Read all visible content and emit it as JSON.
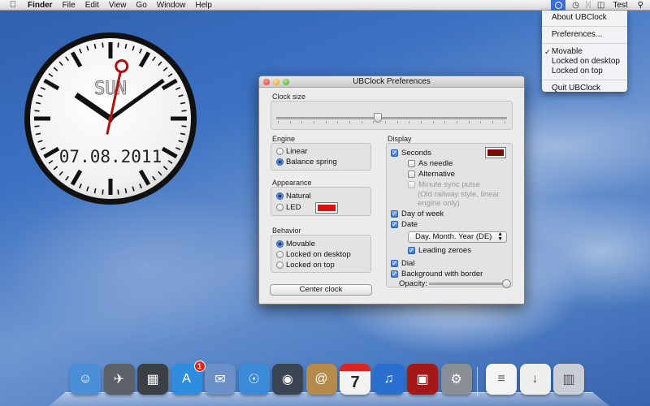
{
  "menubar": {
    "apple_icon": "apple-logo-icon",
    "items": [
      "Finder",
      "File",
      "Edit",
      "View",
      "Go",
      "Window",
      "Help"
    ],
    "status_icons": [
      "ubclock-icon",
      "time-machine-icon",
      "bluetooth-icon",
      "wifi-icon"
    ],
    "user": "Test",
    "spotlight_icon": "spotlight-search-icon"
  },
  "dropdown": {
    "items": [
      {
        "label": "About UBClock",
        "checked": false
      },
      {
        "label": "Preferences...",
        "checked": false
      },
      {
        "label": "Movable",
        "checked": true
      },
      {
        "label": "Locked on desktop",
        "checked": false
      },
      {
        "label": "Locked on top",
        "checked": false
      },
      {
        "label": "Quit UBClock",
        "checked": false
      }
    ]
  },
  "desk_clock": {
    "day": "SUN",
    "date": "07.08.2011",
    "hour": 10,
    "minute": 9,
    "second": 2,
    "accent_color": "#b01010"
  },
  "prefs": {
    "title": "UBClock Preferences",
    "clock_size": {
      "label": "Clock size",
      "value": 0.44
    },
    "engine": {
      "label": "Engine",
      "options": [
        {
          "label": "Linear",
          "selected": false
        },
        {
          "label": "Balance spring",
          "selected": true
        }
      ]
    },
    "appearance": {
      "label": "Appearance",
      "options": [
        {
          "label": "Natural",
          "selected": true
        },
        {
          "label": "LED",
          "selected": false
        }
      ],
      "led_color": "#e01010"
    },
    "behavior": {
      "label": "Behavior",
      "options": [
        {
          "label": "Movable",
          "selected": true
        },
        {
          "label": "Locked on desktop",
          "selected": false
        },
        {
          "label": "Locked on top",
          "selected": false
        }
      ]
    },
    "center_clock_label": "Center clock",
    "display": {
      "label": "Display",
      "seconds": {
        "label": "Seconds",
        "checked": true,
        "color": "#7a0a0a"
      },
      "as_needle": {
        "label": "As needle",
        "checked": false
      },
      "alternative": {
        "label": "Alternative",
        "checked": false
      },
      "minute_sync": {
        "label": "Minute sync pulse",
        "checked": false,
        "enabled": false
      },
      "minute_sync_note_1": "(Old railway style, linear",
      "minute_sync_note_2": "engine only)",
      "day_of_week": {
        "label": "Day of week",
        "checked": true
      },
      "date": {
        "label": "Date",
        "checked": true
      },
      "date_format": "Day. Month. Year (DE)",
      "leading_zeroes": {
        "label": "Leading zeroes",
        "checked": true
      },
      "dial": {
        "label": "Dial",
        "checked": true
      },
      "background_border": {
        "label": "Background with border",
        "checked": true
      },
      "opacity": {
        "label": "Opacity:",
        "value": 1.0
      }
    }
  },
  "dock": {
    "apps": [
      {
        "icon": "finder-icon",
        "color": "#4a8fd8"
      },
      {
        "icon": "launchpad-icon",
        "color": "#5c6068"
      },
      {
        "icon": "mission-control-icon",
        "color": "#3b3f46"
      },
      {
        "icon": "app-store-icon",
        "color": "#2f8de0",
        "badge": "1"
      },
      {
        "icon": "mail-icon",
        "color": "#6b90c8"
      },
      {
        "icon": "safari-icon",
        "color": "#3a8ad8"
      },
      {
        "icon": "facetime-icon",
        "color": "#3b4452"
      },
      {
        "icon": "address-book-icon",
        "color": "#b58a4a"
      },
      {
        "icon": "ical-icon",
        "color": "#f2f2f2",
        "text": "7"
      },
      {
        "icon": "itunes-icon",
        "color": "#2a6fd0"
      },
      {
        "icon": "photo-booth-icon",
        "color": "#a51818"
      },
      {
        "icon": "system-preferences-icon",
        "color": "#8a8f96"
      },
      {
        "icon": "document-icon",
        "color": "#f4f4f4"
      },
      {
        "icon": "downloads-stack-icon",
        "color": "#eef0ee"
      },
      {
        "icon": "trash-icon",
        "color": "#c9ced6"
      }
    ]
  }
}
